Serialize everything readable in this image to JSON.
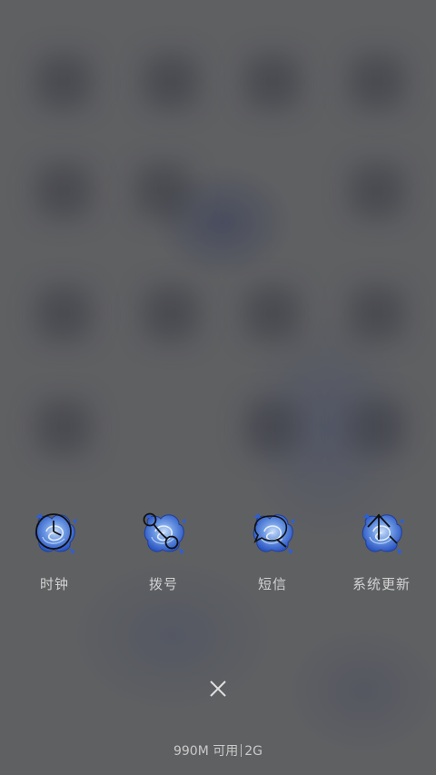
{
  "recents": {
    "apps": [
      {
        "label": "时钟",
        "icon": "clock-icon"
      },
      {
        "label": "拨号",
        "icon": "dialer-icon"
      },
      {
        "label": "短信",
        "icon": "sms-icon"
      },
      {
        "label": "系统更新",
        "icon": "system-update-icon"
      }
    ]
  },
  "close": {
    "icon": "close-icon"
  },
  "memory": {
    "free": "990M 可用",
    "total": "2G"
  },
  "colors": {
    "rose_blue": "#3f72d8",
    "rose_light": "#9cc0f0",
    "line": "#111111",
    "label": "#d2d2d2"
  }
}
